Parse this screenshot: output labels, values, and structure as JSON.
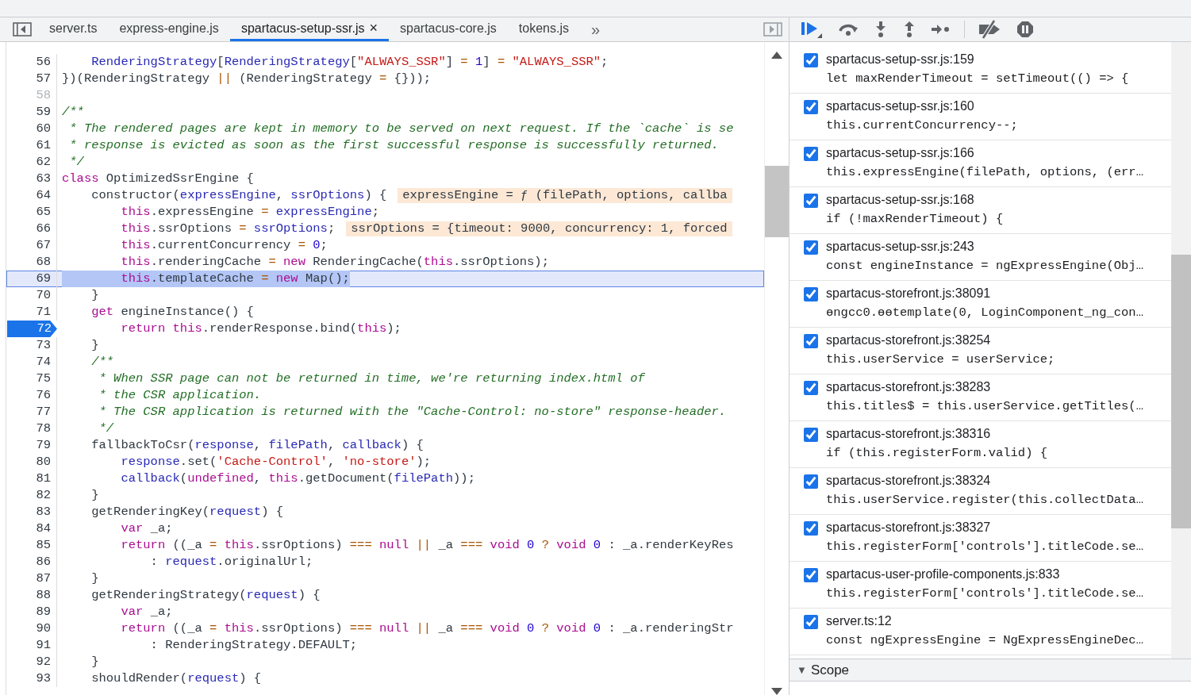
{
  "editor": {
    "tabs": [
      {
        "label": "server.ts",
        "selected": false
      },
      {
        "label": "express-engine.js",
        "selected": false
      },
      {
        "label": "spartacus-setup-ssr.js",
        "selected": true,
        "close": "×"
      },
      {
        "label": "spartacus-core.js",
        "selected": false
      },
      {
        "label": "tokens.js",
        "selected": false
      }
    ],
    "tabs_overflow": "»",
    "lines": [
      {
        "number": "56",
        "paused": false,
        "breakpoint": false,
        "segments": [
          {
            "kind": "variable",
            "text": "    RenderingStrategy"
          },
          {
            "kind": "plain",
            "text": "["
          },
          {
            "kind": "variable",
            "text": "RenderingStrategy"
          },
          {
            "kind": "plain",
            "text": "["
          },
          {
            "kind": "string",
            "text": "\"ALWAYS_SSR\""
          },
          {
            "kind": "plain",
            "text": "] "
          },
          {
            "kind": "operator",
            "text": "= "
          },
          {
            "kind": "number",
            "text": "1"
          },
          {
            "kind": "plain",
            "text": "] "
          },
          {
            "kind": "operator",
            "text": "= "
          },
          {
            "kind": "string",
            "text": "\"ALWAYS_SSR\""
          },
          {
            "kind": "plain",
            "text": ";"
          }
        ]
      },
      {
        "number": "57",
        "paused": false,
        "breakpoint": false,
        "segments": [
          {
            "kind": "plain",
            "text": "})(RenderingStrategy "
          },
          {
            "kind": "operator",
            "text": "|| "
          },
          {
            "kind": "plain",
            "text": "(RenderingStrategy "
          },
          {
            "kind": "operator",
            "text": "= "
          },
          {
            "kind": "plain",
            "text": "{}));"
          }
        ]
      },
      {
        "number": "58",
        "paused": false,
        "breakpoint": false
      },
      {
        "number": "59",
        "paused": false,
        "breakpoint": false,
        "segments": [
          {
            "kind": "comment",
            "text": "/**"
          }
        ]
      },
      {
        "number": "60",
        "paused": false,
        "breakpoint": false,
        "segments": [
          {
            "kind": "comment",
            "text": " * The rendered pages are kept in memory to be served on next request. If the `cache` is se"
          }
        ]
      },
      {
        "number": "61",
        "paused": false,
        "breakpoint": false,
        "segments": [
          {
            "kind": "comment",
            "text": " * response is evicted as soon as the first successful response is successfully returned."
          }
        ]
      },
      {
        "number": "62",
        "paused": false,
        "breakpoint": false,
        "segments": [
          {
            "kind": "comment",
            "text": " */"
          }
        ]
      },
      {
        "number": "63",
        "paused": false,
        "breakpoint": false,
        "segments": [
          {
            "kind": "keyword",
            "text": "class"
          },
          {
            "kind": "plain",
            "text": " OptimizedSsrEngine {"
          }
        ]
      },
      {
        "number": "64",
        "paused": false,
        "breakpoint": false,
        "segments": [
          {
            "kind": "plain",
            "text": "    constructor("
          },
          {
            "kind": "variable",
            "text": "expressEngine"
          },
          {
            "kind": "plain",
            "text": ", "
          },
          {
            "kind": "variable",
            "text": "ssrOptions"
          },
          {
            "kind": "plain",
            "text": ") {"
          }
        ],
        "inline_value": "expressEngine = ƒ (filePath, options, callba"
      },
      {
        "number": "65",
        "paused": false,
        "breakpoint": false,
        "segments": [
          {
            "kind": "keyword",
            "text": "        this"
          },
          {
            "kind": "plain",
            "text": ".expressEngine "
          },
          {
            "kind": "operator",
            "text": "= "
          },
          {
            "kind": "variable",
            "text": "expressEngine"
          },
          {
            "kind": "plain",
            "text": ";"
          }
        ]
      },
      {
        "number": "66",
        "paused": false,
        "breakpoint": false,
        "segments": [
          {
            "kind": "keyword",
            "text": "        this"
          },
          {
            "kind": "plain",
            "text": ".ssrOptions "
          },
          {
            "kind": "operator",
            "text": "= "
          },
          {
            "kind": "variable",
            "text": "ssrOptions"
          },
          {
            "kind": "plain",
            "text": ";"
          }
        ],
        "inline_value": "ssrOptions = {timeout: 9000, concurrency: 1, forced"
      },
      {
        "number": "67",
        "paused": false,
        "breakpoint": false,
        "segments": [
          {
            "kind": "keyword",
            "text": "        this"
          },
          {
            "kind": "plain",
            "text": ".currentConcurrency "
          },
          {
            "kind": "operator",
            "text": "= "
          },
          {
            "kind": "number",
            "text": "0"
          },
          {
            "kind": "plain",
            "text": ";"
          }
        ]
      },
      {
        "number": "68",
        "paused": false,
        "breakpoint": false,
        "segments": [
          {
            "kind": "keyword",
            "text": "        this"
          },
          {
            "kind": "plain",
            "text": ".renderingCache "
          },
          {
            "kind": "operator",
            "text": "= "
          },
          {
            "kind": "keyword",
            "text": "new"
          },
          {
            "kind": "plain",
            "text": " RenderingCache("
          },
          {
            "kind": "keyword",
            "text": "this"
          },
          {
            "kind": "plain",
            "text": ".ssrOptions);"
          }
        ]
      },
      {
        "number": "69",
        "paused": true,
        "breakpoint": false,
        "segments": [
          {
            "kind": "keyword",
            "text": "        this"
          },
          {
            "kind": "plain",
            "text": ".templateCache "
          },
          {
            "kind": "operator",
            "text": "= "
          },
          {
            "kind": "keyword",
            "text": "new"
          },
          {
            "kind": "plain",
            "text": " Map();"
          }
        ]
      },
      {
        "number": "70",
        "paused": false,
        "breakpoint": false,
        "segments": [
          {
            "kind": "plain",
            "text": "    }"
          }
        ]
      },
      {
        "number": "71",
        "paused": false,
        "breakpoint": false,
        "segments": [
          {
            "kind": "keyword",
            "text": "    get"
          },
          {
            "kind": "plain",
            "text": " engineInstance() {"
          }
        ]
      },
      {
        "number": "72",
        "paused": false,
        "breakpoint": true,
        "segments": [
          {
            "kind": "keyword",
            "text": "        return this"
          },
          {
            "kind": "plain",
            "text": ".renderResponse.bind("
          },
          {
            "kind": "keyword",
            "text": "this"
          },
          {
            "kind": "plain",
            "text": ");"
          }
        ]
      },
      {
        "number": "73",
        "paused": false,
        "breakpoint": false,
        "segments": [
          {
            "kind": "plain",
            "text": "    }"
          }
        ]
      },
      {
        "number": "74",
        "paused": false,
        "breakpoint": false,
        "segments": [
          {
            "kind": "comment",
            "text": "    /**"
          }
        ]
      },
      {
        "number": "75",
        "paused": false,
        "breakpoint": false,
        "segments": [
          {
            "kind": "comment",
            "text": "     * When SSR page can not be returned in time, we're returning index.html of"
          }
        ]
      },
      {
        "number": "76",
        "paused": false,
        "breakpoint": false,
        "segments": [
          {
            "kind": "comment",
            "text": "     * the CSR application."
          }
        ]
      },
      {
        "number": "77",
        "paused": false,
        "breakpoint": false,
        "segments": [
          {
            "kind": "comment",
            "text": "     * The CSR application is returned with the \"Cache-Control: no-store\" response-header."
          }
        ]
      },
      {
        "number": "78",
        "paused": false,
        "breakpoint": false,
        "segments": [
          {
            "kind": "comment",
            "text": "     */"
          }
        ]
      },
      {
        "number": "79",
        "paused": false,
        "breakpoint": false,
        "segments": [
          {
            "kind": "plain",
            "text": "    fallbackToCsr("
          },
          {
            "kind": "variable",
            "text": "response"
          },
          {
            "kind": "plain",
            "text": ", "
          },
          {
            "kind": "variable",
            "text": "filePath"
          },
          {
            "kind": "plain",
            "text": ", "
          },
          {
            "kind": "variable",
            "text": "callback"
          },
          {
            "kind": "plain",
            "text": ") {"
          }
        ]
      },
      {
        "number": "80",
        "paused": false,
        "breakpoint": false,
        "segments": [
          {
            "kind": "variable",
            "text": "        response"
          },
          {
            "kind": "plain",
            "text": ".set("
          },
          {
            "kind": "string",
            "text": "'Cache-Control'"
          },
          {
            "kind": "plain",
            "text": ", "
          },
          {
            "kind": "string",
            "text": "'no-store'"
          },
          {
            "kind": "plain",
            "text": ");"
          }
        ]
      },
      {
        "number": "81",
        "paused": false,
        "breakpoint": false,
        "segments": [
          {
            "kind": "variable",
            "text": "        callback"
          },
          {
            "kind": "plain",
            "text": "("
          },
          {
            "kind": "keyword",
            "text": "undefined"
          },
          {
            "kind": "plain",
            "text": ", "
          },
          {
            "kind": "keyword",
            "text": "this"
          },
          {
            "kind": "plain",
            "text": ".getDocument("
          },
          {
            "kind": "variable",
            "text": "filePath"
          },
          {
            "kind": "plain",
            "text": "));"
          }
        ]
      },
      {
        "number": "82",
        "paused": false,
        "breakpoint": false,
        "segments": [
          {
            "kind": "plain",
            "text": "    }"
          }
        ]
      },
      {
        "number": "83",
        "paused": false,
        "breakpoint": false,
        "segments": [
          {
            "kind": "plain",
            "text": "    getRenderingKey("
          },
          {
            "kind": "variable",
            "text": "request"
          },
          {
            "kind": "plain",
            "text": ") {"
          }
        ]
      },
      {
        "number": "84",
        "paused": false,
        "breakpoint": false,
        "segments": [
          {
            "kind": "keyword",
            "text": "        var"
          },
          {
            "kind": "plain",
            "text": " _a;"
          }
        ]
      },
      {
        "number": "85",
        "paused": false,
        "breakpoint": false,
        "segments": [
          {
            "kind": "keyword",
            "text": "        return"
          },
          {
            "kind": "plain",
            "text": " ((_a "
          },
          {
            "kind": "operator",
            "text": "= "
          },
          {
            "kind": "keyword",
            "text": "this"
          },
          {
            "kind": "plain",
            "text": ".ssrOptions) "
          },
          {
            "kind": "operator",
            "text": "=== "
          },
          {
            "kind": "keyword",
            "text": "null"
          },
          {
            "kind": "operator",
            "text": " ||"
          },
          {
            "kind": "plain",
            "text": " _a "
          },
          {
            "kind": "operator",
            "text": "=== "
          },
          {
            "kind": "keyword",
            "text": "void"
          },
          {
            "kind": "number",
            "text": " 0"
          },
          {
            "kind": "operator",
            "text": " ? "
          },
          {
            "kind": "keyword",
            "text": "void"
          },
          {
            "kind": "number",
            "text": " 0"
          },
          {
            "kind": "plain",
            "text": " : _a.renderKeyRes"
          }
        ]
      },
      {
        "number": "86",
        "paused": false,
        "breakpoint": false,
        "segments": [
          {
            "kind": "plain",
            "text": "            : "
          },
          {
            "kind": "variable",
            "text": "request"
          },
          {
            "kind": "plain",
            "text": ".originalUrl;"
          }
        ]
      },
      {
        "number": "87",
        "paused": false,
        "breakpoint": false,
        "segments": [
          {
            "kind": "plain",
            "text": "    }"
          }
        ]
      },
      {
        "number": "88",
        "paused": false,
        "breakpoint": false,
        "segments": [
          {
            "kind": "plain",
            "text": "    getRenderingStrategy("
          },
          {
            "kind": "variable",
            "text": "request"
          },
          {
            "kind": "plain",
            "text": ") {"
          }
        ]
      },
      {
        "number": "89",
        "paused": false,
        "breakpoint": false,
        "segments": [
          {
            "kind": "keyword",
            "text": "        var"
          },
          {
            "kind": "plain",
            "text": " _a;"
          }
        ]
      },
      {
        "number": "90",
        "paused": false,
        "breakpoint": false,
        "segments": [
          {
            "kind": "keyword",
            "text": "        return"
          },
          {
            "kind": "plain",
            "text": " ((_a "
          },
          {
            "kind": "operator",
            "text": "= "
          },
          {
            "kind": "keyword",
            "text": "this"
          },
          {
            "kind": "plain",
            "text": ".ssrOptions) "
          },
          {
            "kind": "operator",
            "text": "=== "
          },
          {
            "kind": "keyword",
            "text": "null"
          },
          {
            "kind": "operator",
            "text": " ||"
          },
          {
            "kind": "plain",
            "text": " _a "
          },
          {
            "kind": "operator",
            "text": "=== "
          },
          {
            "kind": "keyword",
            "text": "void"
          },
          {
            "kind": "number",
            "text": " 0"
          },
          {
            "kind": "operator",
            "text": " ? "
          },
          {
            "kind": "keyword",
            "text": "void"
          },
          {
            "kind": "number",
            "text": " 0"
          },
          {
            "kind": "plain",
            "text": " : _a.renderingStr"
          }
        ]
      },
      {
        "number": "91",
        "paused": false,
        "breakpoint": false,
        "segments": [
          {
            "kind": "plain",
            "text": "            : RenderingStrategy.DEFAULT;"
          }
        ]
      },
      {
        "number": "92",
        "paused": false,
        "breakpoint": false,
        "segments": [
          {
            "kind": "plain",
            "text": "    }"
          }
        ]
      },
      {
        "number": "93",
        "paused": false,
        "breakpoint": false,
        "segments": [
          {
            "kind": "plain",
            "text": "    shouldRender("
          },
          {
            "kind": "variable",
            "text": "request"
          },
          {
            "kind": "plain",
            "text": ") {"
          }
        ]
      }
    ]
  },
  "breakpoints": [
    {
      "location": "spartacus-setup-ssr.js:159",
      "code": "let maxRenderTimeout = setTimeout(() => {",
      "checked": true
    },
    {
      "location": "spartacus-setup-ssr.js:160",
      "code": "this.currentConcurrency--;",
      "checked": true
    },
    {
      "location": "spartacus-setup-ssr.js:166",
      "code": "this.expressEngine(filePath, options, (err…",
      "checked": true
    },
    {
      "location": "spartacus-setup-ssr.js:168",
      "code": "if (!maxRenderTimeout) {",
      "checked": true
    },
    {
      "location": "spartacus-setup-ssr.js:243",
      "code": "const engineInstance = ngExpressEngine(Obj…",
      "checked": true
    },
    {
      "location": "spartacus-storefront.js:38091",
      "code": "ɵngcc0.ɵɵtemplate(0, LoginComponent_ng_con…",
      "checked": true
    },
    {
      "location": "spartacus-storefront.js:38254",
      "code": "this.userService = userService;",
      "checked": true
    },
    {
      "location": "spartacus-storefront.js:38283",
      "code": "this.titles$ = this.userService.getTitles(…",
      "checked": true
    },
    {
      "location": "spartacus-storefront.js:38316",
      "code": "if (this.registerForm.valid) {",
      "checked": true
    },
    {
      "location": "spartacus-storefront.js:38324",
      "code": "this.userService.register(this.collectData…",
      "checked": true
    },
    {
      "location": "spartacus-storefront.js:38327",
      "code": "this.registerForm['controls'].titleCode.se…",
      "checked": true
    },
    {
      "location": "spartacus-user-profile-components.js:833",
      "code": "this.registerForm['controls'].titleCode.se…",
      "checked": true
    },
    {
      "location": "server.ts:12",
      "code": "const ngExpressEngine = NgExpressEngineDec…",
      "checked": true
    }
  ],
  "scope": {
    "toggle": "▼",
    "label": "Scope",
    "expanded": true
  }
}
